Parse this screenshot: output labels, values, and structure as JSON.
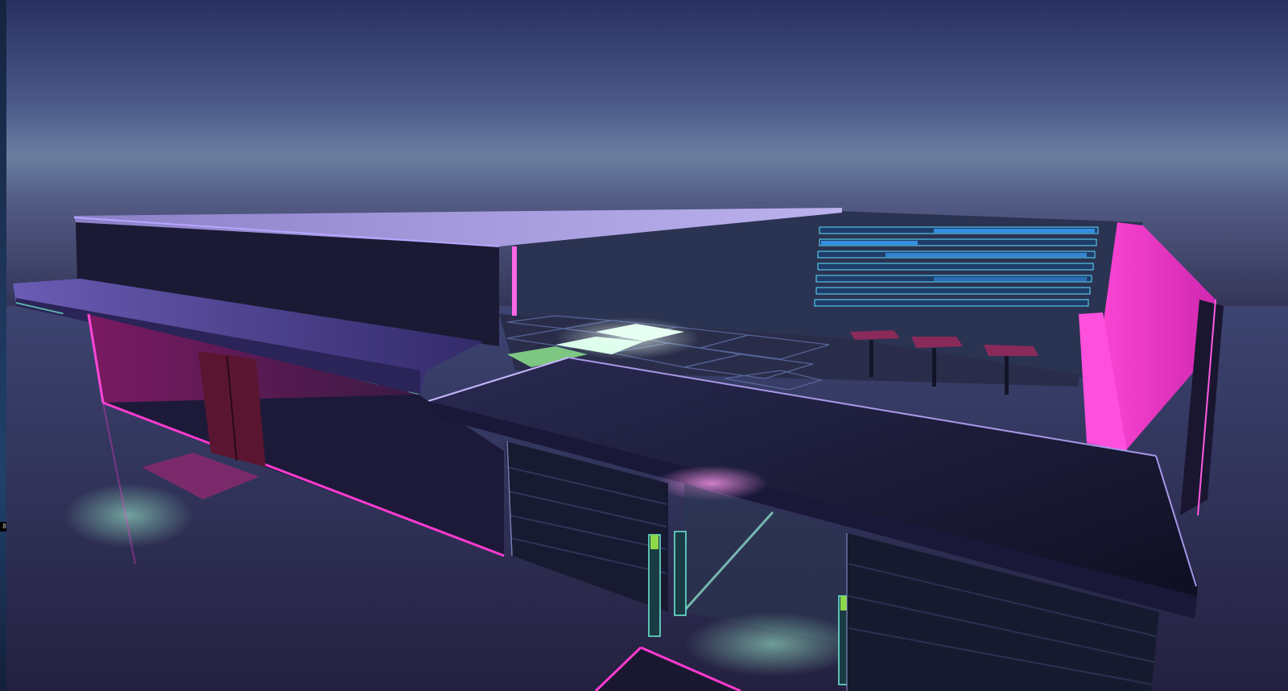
{
  "viewport": {
    "edge_stat": "8"
  },
  "scene": {
    "sky_top": "#2b3461",
    "sky_horizon": "#66789a",
    "ground": "#2a2a4c",
    "neon_pink": "#ff3bd0",
    "neon_cyan": "#5ee0ff",
    "neon_green": "#9dffc8",
    "roof_top": "#b2a7e6",
    "wall_dark": "#1c1c38"
  }
}
